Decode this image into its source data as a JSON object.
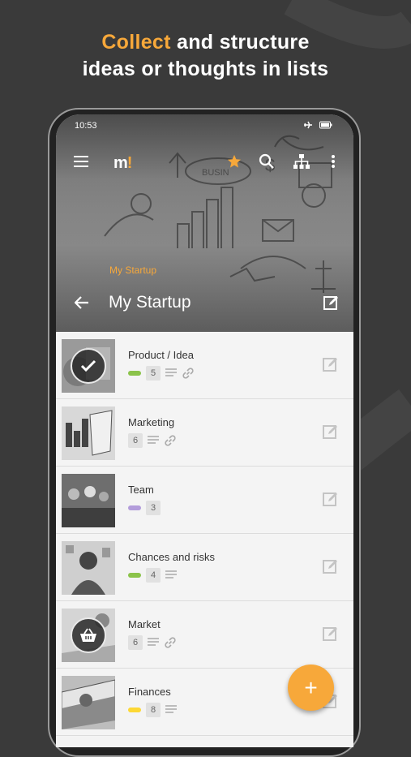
{
  "promo": {
    "accent": "Collect",
    "rest_line1": " and structure",
    "line2": "ideas or thoughts in lists"
  },
  "status_bar": {
    "time": "10:53"
  },
  "toolbar": {
    "logo_m": "m",
    "logo_ex": "!",
    "icons": [
      "menu-icon",
      "star-icon",
      "search-icon",
      "hierarchy-icon",
      "more-vert-icon"
    ]
  },
  "header": {
    "subtitle": "My Startup",
    "title": "My Startup"
  },
  "list": {
    "items": [
      {
        "title": "Product / Idea",
        "tag_color": "#8bc34a",
        "count": "5",
        "has_note": true,
        "has_link": true,
        "overlay": "check"
      },
      {
        "title": "Marketing",
        "tag_color": "",
        "count": "6",
        "has_note": true,
        "has_link": true,
        "overlay": ""
      },
      {
        "title": "Team",
        "tag_color": "#b39ddb",
        "count": "3",
        "has_note": false,
        "has_link": false,
        "overlay": ""
      },
      {
        "title": "Chances and risks",
        "tag_color": "#8bc34a",
        "count": "4",
        "has_note": true,
        "has_link": false,
        "overlay": ""
      },
      {
        "title": "Market",
        "tag_color": "",
        "count": "6",
        "has_note": true,
        "has_link": true,
        "overlay": "basket"
      },
      {
        "title": "Finances",
        "tag_color": "#fdd835",
        "count": "8",
        "has_note": true,
        "has_link": false,
        "overlay": ""
      }
    ]
  },
  "fab": {
    "label": "+"
  },
  "colors": {
    "accent": "#f7a83a",
    "background": "#3a3a3a"
  }
}
